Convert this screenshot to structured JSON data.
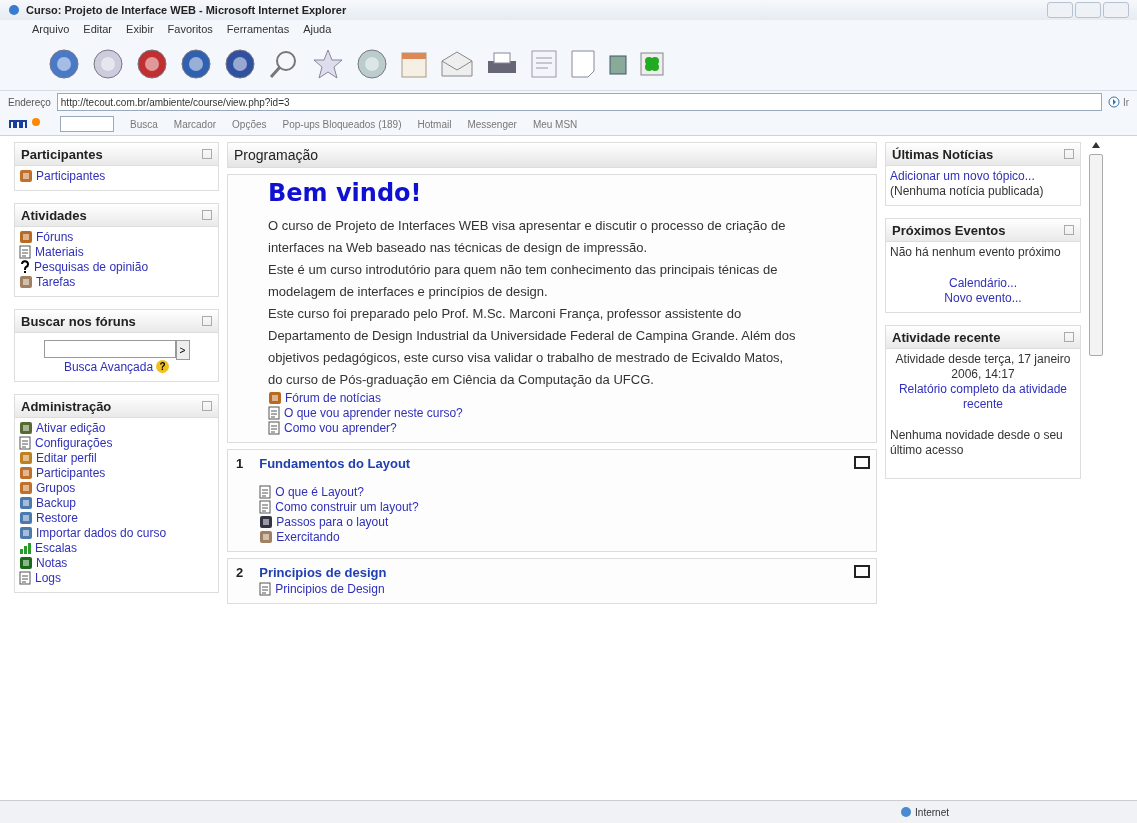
{
  "window": {
    "title": "Curso: Projeto de Interface WEB - Microsoft Internet Explorer"
  },
  "menu": [
    "Arquivo",
    "Editar",
    "Exibir",
    "Favoritos",
    "Ferramentas",
    "Ajuda"
  ],
  "address_bar": {
    "label": "Endereço",
    "value": "http://tecout.com.br/ambiente/course/view.php?id=3",
    "go": "Ir"
  },
  "msn_bar": {
    "items": [
      "Busca",
      "Marcador",
      "Opções",
      "Pop-ups Bloqueados (189)",
      "Hotmail",
      "Messenger",
      "Meu MSN"
    ]
  },
  "left_blocks": [
    {
      "title": "Participantes",
      "items": [
        {
          "label": "Participantes",
          "kind": "people"
        }
      ]
    },
    {
      "title": "Atividades",
      "items": [
        {
          "label": "Fóruns",
          "kind": "forum"
        },
        {
          "label": "Materiais",
          "kind": "page"
        },
        {
          "label": "Pesquisas de opinião",
          "kind": "question"
        },
        {
          "label": "Tarefas",
          "kind": "task"
        }
      ]
    },
    {
      "title": "Buscar nos fóruns",
      "kind": "search",
      "button": ">",
      "link": "Busca Avançada",
      "help": "?"
    },
    {
      "title": "Administração",
      "items": [
        {
          "label": "Ativar edição",
          "kind": "pen"
        },
        {
          "label": "Configurações",
          "kind": "page"
        },
        {
          "label": "Editar perfil",
          "kind": "person"
        },
        {
          "label": "Participantes",
          "kind": "people"
        },
        {
          "label": "Grupos",
          "kind": "people"
        },
        {
          "label": "Backup",
          "kind": "box"
        },
        {
          "label": "Restore",
          "kind": "box"
        },
        {
          "label": "Importar dados do curso",
          "kind": "box"
        },
        {
          "label": "Escalas",
          "kind": "chart"
        },
        {
          "label": "Notas",
          "kind": "grid"
        },
        {
          "label": "Logs",
          "kind": "page"
        }
      ]
    }
  ],
  "main": {
    "title": "Programação",
    "welcome": {
      "heading": "Bem vindo!",
      "paragraphs": [
        "O curso de Projeto de Interfaces WEB visa apresentar e discutir o processo de criação de interfaces na Web baseado nas técnicas de design de impressão.",
        "Este é um curso introdutório para quem não tem conhecimento das principais ténicas de modelagem de interfaces e princípios de design.",
        "Este curso foi preparado pelo Prof. M.Sc. Marconi França, professor assistente do Departamento de Design Industrial da Universidade Federal de Campina Grande. Além dos objetivos pedagógicos, este curso visa validar o trabalho de mestrado de Ecivaldo Matos, do curso de Pós-graduação em Ciência da Computação da UFCG."
      ],
      "items": [
        {
          "label": "Fórum de notícias",
          "kind": "forum"
        },
        {
          "label": "O que vou aprender neste curso?",
          "kind": "page"
        },
        {
          "label": "Como vou aprender?",
          "kind": "page"
        }
      ]
    },
    "topics": [
      {
        "number": "1",
        "title": "Fundamentos do Layout",
        "items": [
          {
            "label": "O que é Layout?",
            "kind": "page"
          },
          {
            "label": "Como construir um layout?",
            "kind": "page"
          },
          {
            "label": "Passos para o layout",
            "kind": "image"
          },
          {
            "label": "Exercitando",
            "kind": "task"
          }
        ]
      },
      {
        "number": "2",
        "title": "Principios de design",
        "items": [
          {
            "label": "Principios de Design",
            "kind": "page"
          }
        ]
      }
    ]
  },
  "right_blocks": [
    {
      "title": "Últimas Notícias",
      "kind": "news",
      "link": "Adicionar um novo tópico...",
      "text": "(Nenhuma notícia publicada)"
    },
    {
      "title": "Próximos Eventos",
      "kind": "events",
      "text": "Não há nenhum evento próximo",
      "links": [
        "Calendário...",
        "Novo evento..."
      ]
    },
    {
      "title": "Atividade recente",
      "kind": "recent",
      "since": "Atividade desde terça, 17 janeiro 2006, 14:17",
      "link": "Relatório completo da atividade recente",
      "text": "Nenhuma novidade desde o seu último acesso"
    }
  ],
  "status_bar": {
    "zone": "Internet"
  }
}
